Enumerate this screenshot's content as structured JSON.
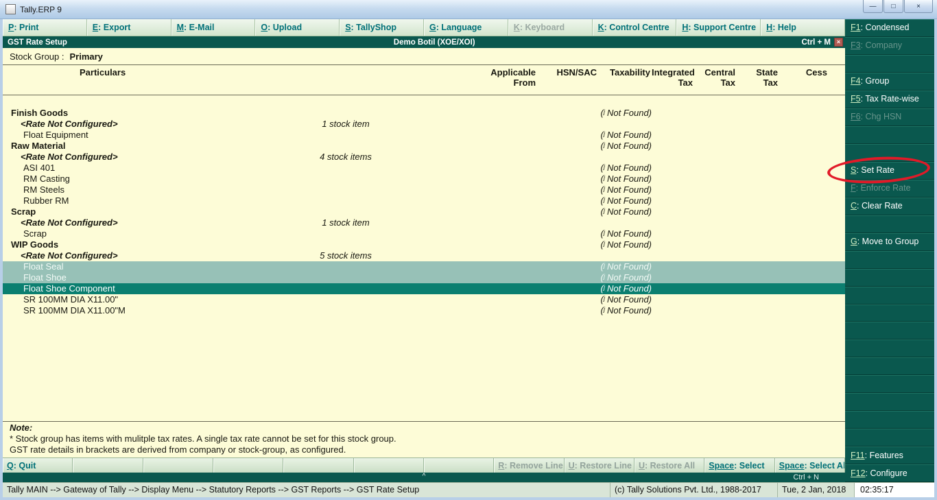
{
  "colors": {
    "dark_green": "#0a584e",
    "cream_background": "#fdfcd7",
    "selection_light": "#97c1b7",
    "selection_cursor": "#0b7f70",
    "annotation_red": "#e11a28",
    "menu_text_teal": "#007078"
  },
  "window": {
    "title": "Tally.ERP 9",
    "controls": [
      {
        "name": "minimize",
        "glyph": "—"
      },
      {
        "name": "maximize",
        "glyph": "□"
      },
      {
        "name": "close",
        "glyph": "×"
      }
    ]
  },
  "menubar": {
    "items": [
      {
        "key": "P",
        "label": "Print",
        "enabled": true
      },
      {
        "key": "E",
        "label": "Export",
        "enabled": true
      },
      {
        "key": "M",
        "label": "E-Mail",
        "enabled": true
      },
      {
        "key": "O",
        "label": "Upload",
        "enabled": true
      },
      {
        "key": "S",
        "label": "TallyShop",
        "enabled": true
      },
      {
        "key": "G",
        "label": "Language",
        "enabled": true
      },
      {
        "key": "K",
        "label": "Keyboard",
        "enabled": false
      },
      {
        "key": "K",
        "label": "Control Centre",
        "enabled": true
      },
      {
        "key": "H",
        "label": "Support Centre",
        "enabled": true
      },
      {
        "key": "H",
        "label": "Help",
        "enabled": true
      }
    ]
  },
  "report_header": {
    "title": "GST Rate Setup",
    "company": "Demo Botil (XOE/XOI)",
    "shortcut": "Ctrl + M",
    "close_glyph": "×"
  },
  "stock_group": {
    "label": "Stock Group :",
    "value": "Primary"
  },
  "table": {
    "columns": [
      "Particulars",
      "Applicable\nFrom",
      "HSN/SAC",
      "Taxability",
      "Integrated\nTax",
      "Central\nTax",
      "State\nTax",
      "Cess"
    ],
    "inherited_value": "(ʲ Not Found)",
    "rows": [
      {
        "name": "Finish Goods",
        "style": "group",
        "not_found": true
      },
      {
        "name": "<Rate Not Configured>",
        "style": "rate",
        "count": "1 stock item"
      },
      {
        "name": "Float Equipment",
        "style": "item",
        "not_found": true
      },
      {
        "name": "Raw Material",
        "style": "group",
        "not_found": true
      },
      {
        "name": "<Rate Not Configured>",
        "style": "rate",
        "count": "4 stock items"
      },
      {
        "name": "ASI 401",
        "style": "item",
        "not_found": true
      },
      {
        "name": "RM Casting",
        "style": "item",
        "not_found": true
      },
      {
        "name": "RM Steels",
        "style": "item",
        "not_found": true
      },
      {
        "name": "Rubber RM",
        "style": "item",
        "not_found": true
      },
      {
        "name": "Scrap",
        "style": "group",
        "not_found": true
      },
      {
        "name": "<Rate Not Configured>",
        "style": "rate",
        "count": "1 stock item"
      },
      {
        "name": "Scrap",
        "style": "item",
        "not_found": true
      },
      {
        "name": "WIP Goods",
        "style": "group",
        "not_found": true
      },
      {
        "name": "<Rate Not Configured>",
        "style": "rate",
        "count": "5 stock items"
      },
      {
        "name": "Float Seal",
        "style": "item",
        "not_found": true,
        "selected": "multi"
      },
      {
        "name": "Float Shoe",
        "style": "item",
        "not_found": true,
        "selected": "multi"
      },
      {
        "name": "Float Shoe Component",
        "style": "item",
        "not_found": true,
        "selected": "cursor"
      },
      {
        "name": "SR 100MM DIA X11.00\"",
        "style": "item",
        "not_found": true
      },
      {
        "name": "SR 100MM DIA X11.00\"M",
        "style": "item",
        "not_found": true
      }
    ]
  },
  "note": {
    "title": "Note:",
    "lines": [
      "* Stock group has items with mulitple tax rates. A single tax rate cannot be set for this stock group.",
      "GST rate details in brackets are derived from company or stock-group, as configured."
    ]
  },
  "command_bar": {
    "buttons": [
      {
        "key": "Q",
        "label": "Quit",
        "enabled": true
      },
      {
        "key": "",
        "label": "",
        "enabled": false
      },
      {
        "key": "",
        "label": "",
        "enabled": false
      },
      {
        "key": "",
        "label": "",
        "enabled": false
      },
      {
        "key": "",
        "label": "",
        "enabled": false
      },
      {
        "key": "",
        "label": "",
        "enabled": false
      },
      {
        "key": "",
        "label": "",
        "enabled": false
      },
      {
        "key": "R",
        "label": "Remove Line",
        "enabled": false
      },
      {
        "key": "U",
        "label": "Restore Line",
        "enabled": false
      },
      {
        "key": "U",
        "label": "Restore All",
        "enabled": false
      },
      {
        "key": "Space",
        "label": "Select",
        "enabled": true
      },
      {
        "key": "Space",
        "label": "Select All",
        "enabled": true
      }
    ],
    "collapse_indicator": "^",
    "shortcut": "Ctrl + N"
  },
  "sidebar": {
    "buttons": [
      {
        "key": "F1",
        "label": "Condensed",
        "enabled": true
      },
      {
        "key": "F3",
        "label": "Company",
        "enabled": false
      },
      {
        "key": "",
        "label": "",
        "enabled": false
      },
      {
        "key": "F4",
        "label": "Group",
        "enabled": true
      },
      {
        "key": "F5",
        "label": "Tax Rate-wise",
        "enabled": true
      },
      {
        "key": "F6",
        "label": "Chg HSN",
        "enabled": false
      },
      {
        "key": "",
        "label": "",
        "enabled": false
      },
      {
        "key": "",
        "label": "",
        "enabled": false
      },
      {
        "key": "S",
        "label": "Set Rate",
        "enabled": true,
        "annotated": true
      },
      {
        "key": "F",
        "label": "Enforce Rate",
        "enabled": false
      },
      {
        "key": "C",
        "label": "Clear Rate",
        "enabled": true
      },
      {
        "key": "",
        "label": "",
        "enabled": false
      },
      {
        "key": "G",
        "label": "Move to Group",
        "enabled": true
      },
      {
        "key": "",
        "label": "",
        "enabled": false
      },
      {
        "key": "",
        "label": "",
        "enabled": false
      },
      {
        "key": "",
        "label": "",
        "enabled": false
      },
      {
        "key": "",
        "label": "",
        "enabled": false
      },
      {
        "key": "",
        "label": "",
        "enabled": false
      },
      {
        "key": "",
        "label": "",
        "enabled": false
      },
      {
        "key": "",
        "label": "",
        "enabled": false
      },
      {
        "key": "",
        "label": "",
        "enabled": false
      },
      {
        "key": "",
        "label": "",
        "enabled": false
      },
      {
        "key": "",
        "label": "",
        "enabled": false
      },
      {
        "key": "",
        "label": "",
        "enabled": false
      },
      {
        "key": "F11",
        "label": "Features",
        "enabled": true
      },
      {
        "key": "F12",
        "label": "Configure",
        "enabled": true
      }
    ]
  },
  "statusbar": {
    "path": "Tally MAIN --> Gateway of Tally --> Display Menu --> Statutory Reports --> GST Reports --> GST Rate Setup",
    "copyright": "(c) Tally Solutions Pvt. Ltd., 1988-2017",
    "date": "Tue, 2 Jan, 2018",
    "time": "02:35:17"
  }
}
